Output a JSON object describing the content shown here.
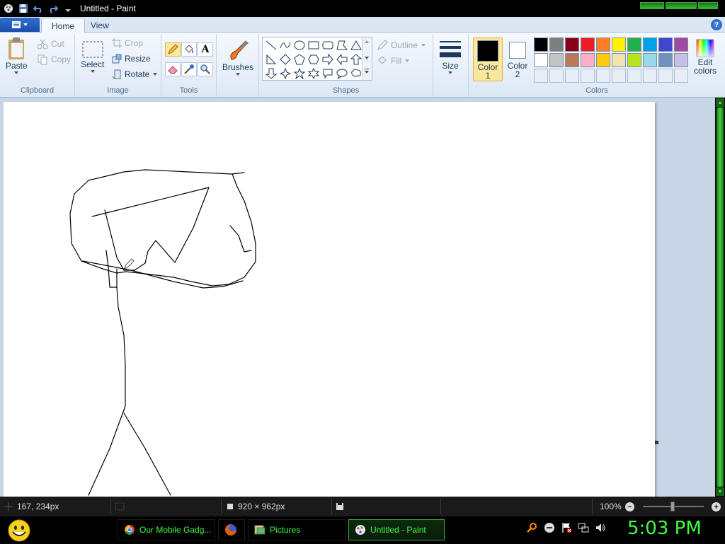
{
  "window": {
    "title": "Untitled - Paint"
  },
  "tabs": [
    {
      "label": "Home"
    },
    {
      "label": "View"
    }
  ],
  "ribbon": {
    "clipboard": {
      "label": "Clipboard",
      "paste": "Paste",
      "cut": "Cut",
      "copy": "Copy"
    },
    "image": {
      "label": "Image",
      "select": "Select",
      "crop": "Crop",
      "resize": "Resize",
      "rotate": "Rotate"
    },
    "tools": {
      "label": "Tools",
      "text_tool": "A"
    },
    "brushes": {
      "label": "Brushes"
    },
    "shapes": {
      "label": "Shapes",
      "outline": "Outline",
      "fill": "Fill"
    },
    "size": {
      "label": "Size"
    },
    "colors": {
      "label": "Colors",
      "color1": "Color 1",
      "color1_value": "#000000",
      "color2": "Color 2",
      "color2_value": "#ffffff",
      "edit": "Edit colors",
      "palette_row1": [
        "#000000",
        "#7f7f7f",
        "#880015",
        "#ed1c24",
        "#ff7f27",
        "#fff200",
        "#22b14c",
        "#00a2e8",
        "#3f48cc",
        "#a349a4"
      ],
      "palette_row2": [
        "#ffffff",
        "#c3c3c3",
        "#b97a57",
        "#ffaec9",
        "#ffc90e",
        "#efe4b0",
        "#b5e61d",
        "#99d9ea",
        "#7092be",
        "#c8bfe7"
      ]
    }
  },
  "status": {
    "cursor_pos": "167, 234px",
    "canvas_size": "920 × 962px",
    "zoom": "100%"
  },
  "taskbar": {
    "items": [
      {
        "label": "Our Mobile Gadg...",
        "icon": "chrome-icon"
      },
      {
        "label": "",
        "icon": "firefox-icon"
      },
      {
        "label": "Pictures",
        "icon": "folder-icon"
      },
      {
        "label": "Untitled - Paint",
        "icon": "paint-icon"
      }
    ],
    "clock": "5:03 PM"
  },
  "colors": {
    "taskbar_text": "#3dff3d",
    "accent": "#fde79a"
  }
}
